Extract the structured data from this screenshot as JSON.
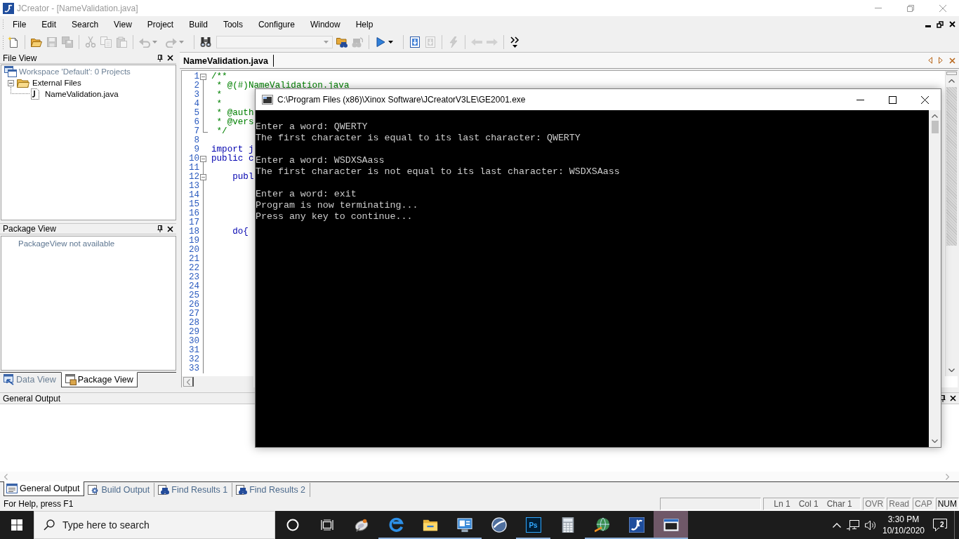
{
  "window": {
    "title": "JCreator - [NameValidation.java]",
    "active": false
  },
  "menu": [
    "File",
    "Edit",
    "Search",
    "View",
    "Project",
    "Build",
    "Tools",
    "Configure",
    "Window",
    "Help"
  ],
  "toolbar": [
    {
      "kind": "new",
      "disabled": false
    },
    {
      "kind": "separator"
    },
    {
      "kind": "open",
      "disabled": false
    },
    {
      "kind": "save",
      "disabled": true
    },
    {
      "kind": "saveall",
      "disabled": true
    },
    {
      "kind": "separator"
    },
    {
      "kind": "cut",
      "disabled": true
    },
    {
      "kind": "copy",
      "disabled": true
    },
    {
      "kind": "paste",
      "disabled": true
    },
    {
      "kind": "separator"
    },
    {
      "kind": "undo",
      "disabled": true
    },
    {
      "kind": "dropdown",
      "disabled": true
    },
    {
      "kind": "redo",
      "disabled": true
    },
    {
      "kind": "dropdown",
      "disabled": true
    },
    {
      "kind": "separator"
    },
    {
      "kind": "find",
      "disabled": false
    },
    {
      "kind": "combo",
      "disabled": true
    },
    {
      "kind": "findfiles",
      "disabled": false
    },
    {
      "kind": "replace",
      "disabled": true
    },
    {
      "kind": "separator"
    },
    {
      "kind": "run",
      "disabled": false
    },
    {
      "kind": "dropdown",
      "disabled": false
    },
    {
      "kind": "separator"
    },
    {
      "kind": "compile",
      "disabled": false
    },
    {
      "kind": "stop",
      "disabled": true
    },
    {
      "kind": "separator"
    },
    {
      "kind": "tool",
      "disabled": true
    },
    {
      "kind": "separator"
    },
    {
      "kind": "back",
      "disabled": true
    },
    {
      "kind": "forward",
      "disabled": true
    },
    {
      "kind": "separator"
    },
    {
      "kind": "more",
      "disabled": false
    }
  ],
  "file_view": {
    "title": "File View",
    "tree": [
      {
        "label": "Workspace 'Default': 0 Projects",
        "kind": "workspace",
        "children": [
          {
            "label": "External Files",
            "kind": "folder",
            "expanded": true,
            "children": [
              {
                "label": "NameValidation.java",
                "kind": "file"
              }
            ]
          }
        ]
      }
    ]
  },
  "package_view": {
    "title": "Package View",
    "message": "PackageView not available"
  },
  "side_tabs": [
    {
      "label": "Data View",
      "kind": "data",
      "selected": false
    },
    {
      "label": "Package View",
      "kind": "package",
      "selected": true
    }
  ],
  "editor": {
    "tabs": [
      {
        "label": "NameValidation.java",
        "selected": true
      }
    ],
    "lines": [
      {
        "number": "1",
        "text": "/**",
        "kind": "comment",
        "expanded": true
      },
      {
        "number": "2",
        "text": " * @(#)NameValidation.java",
        "kind": "comment"
      },
      {
        "number": "3",
        "text": " *",
        "kind": "comment"
      },
      {
        "number": "4",
        "text": " *",
        "kind": "comment"
      },
      {
        "number": "5",
        "text": " * @auth",
        "kind": "comment"
      },
      {
        "number": "6",
        "text": " * @vers",
        "kind": "comment"
      },
      {
        "number": "7",
        "text": " */",
        "kind": "comment",
        "fold_end": true
      },
      {
        "number": "8"
      },
      {
        "number": "9",
        "text": "import j",
        "kind": "code"
      },
      {
        "number": "10",
        "text": "public c",
        "kind": "code",
        "expanded": true
      },
      {
        "number": "11"
      },
      {
        "number": "12",
        "text": "    publ",
        "kind": "code",
        "expanded": true
      },
      {
        "number": "13"
      },
      {
        "number": "14"
      },
      {
        "number": "15"
      },
      {
        "number": "16"
      },
      {
        "number": "17"
      },
      {
        "number": "18",
        "text": "    do{",
        "kind": "code"
      },
      {
        "number": "19"
      },
      {
        "number": "20"
      },
      {
        "number": "21"
      },
      {
        "number": "22"
      },
      {
        "number": "23"
      },
      {
        "number": "24"
      },
      {
        "number": "25"
      },
      {
        "number": "26"
      },
      {
        "number": "27"
      },
      {
        "number": "28"
      },
      {
        "number": "29"
      },
      {
        "number": "30"
      },
      {
        "number": "31"
      },
      {
        "number": "32"
      },
      {
        "number": "33"
      }
    ]
  },
  "output": {
    "title": "General Output",
    "tabs": [
      {
        "label": "General Output",
        "kind": "list",
        "selected": true
      },
      {
        "label": "Build Output",
        "kind": "build",
        "selected": false
      },
      {
        "label": "Find Results 1",
        "kind": "find",
        "selected": false
      },
      {
        "label": "Find Results 2",
        "kind": "find",
        "selected": false
      }
    ]
  },
  "status_bar": {
    "message": "For Help, press F1",
    "fields": [
      "Ln 1",
      "Col 1",
      "Char 1"
    ],
    "indicators": [
      {
        "label": "OVR",
        "on": false
      },
      {
        "label": "Read",
        "on": false
      },
      {
        "label": "CAP",
        "on": false
      },
      {
        "label": "NUM",
        "on": true
      }
    ]
  },
  "console": {
    "title": "C:\\Program Files (x86)\\Xinox Software\\JCreatorV3LE\\GE2001.exe",
    "blocks": [
      [
        "Enter a word: QWERTY",
        "The first character is equal to its last character: QWERTY"
      ],
      [
        "Enter a word: WSDXSAass",
        "The first character is not equal to its last character: WSDXSAass"
      ],
      [
        "Enter a word: exit",
        "Program is now terminating...",
        "Press any key to continue..."
      ]
    ]
  },
  "taskbar": {
    "search": {
      "placeholder": "Type here to search"
    },
    "apps": [
      {
        "kind": "dish",
        "running": false,
        "selected": false
      },
      {
        "kind": "edge",
        "running": true,
        "selected": false
      },
      {
        "kind": "folder",
        "running": true,
        "selected": false
      },
      {
        "kind": "panel",
        "running": true,
        "selected": false
      },
      {
        "kind": "orb",
        "running": false,
        "selected": false
      },
      {
        "kind": "ps",
        "label": "Ps",
        "running": true,
        "selected": false
      },
      {
        "kind": "calculator",
        "running": false,
        "selected": false
      },
      {
        "kind": "globe",
        "running": true,
        "selected": false
      },
      {
        "kind": "jc",
        "running": true,
        "selected": false
      },
      {
        "kind": "console",
        "running": true,
        "selected": true
      }
    ],
    "clock": {
      "time": "3:30 PM",
      "date": "10/10/2020"
    },
    "notification_count": "2"
  }
}
